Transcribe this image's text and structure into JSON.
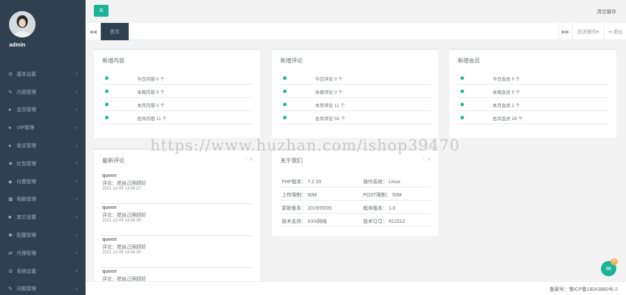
{
  "sidebar": {
    "username": "admin",
    "items": [
      {
        "icon": "gear-icon",
        "glyph": "⚙",
        "label": "基本设置"
      },
      {
        "icon": "edit-icon",
        "glyph": "✎",
        "label": "内容管理"
      },
      {
        "icon": "user-icon",
        "glyph": "●",
        "label": "会员管理"
      },
      {
        "icon": "user-icon",
        "glyph": "●",
        "label": "VIP管理"
      },
      {
        "icon": "user-icon",
        "glyph": "●",
        "label": "收支管理"
      },
      {
        "icon": "gift-icon",
        "glyph": "❖",
        "label": "红包管理"
      },
      {
        "icon": "cart-icon",
        "glyph": "◆",
        "label": "付费管理"
      },
      {
        "icon": "grid-icon",
        "glyph": "▦",
        "label": "相册管理"
      },
      {
        "icon": "square-icon",
        "glyph": "■",
        "label": "其它设置"
      },
      {
        "icon": "snowflake-icon",
        "glyph": "✱",
        "label": "配置管理"
      },
      {
        "icon": "exchange-icon",
        "glyph": "⇄",
        "label": "代理管理"
      },
      {
        "icon": "cogs-icon",
        "glyph": "⚙",
        "label": "系统设置"
      },
      {
        "icon": "edit-icon",
        "glyph": "✎",
        "label": "问题管理"
      }
    ]
  },
  "topbar": {
    "clear_cache": "清空缓存"
  },
  "tabbar": {
    "home_tab": "首页",
    "close_ops": "关闭操作▾",
    "exit": "退出"
  },
  "cards": {
    "new_content": {
      "title": "新增内容",
      "rows": [
        "今日内容 0 个",
        "本周内容 0 个",
        "本月内容 0 个",
        "总共内容 11 个"
      ]
    },
    "new_comments": {
      "title": "新增评论",
      "rows": [
        "今日评论 0 个",
        "本周评论 0 个",
        "本月评论 11 个",
        "总共评论 55 个"
      ]
    },
    "new_members": {
      "title": "新增会员",
      "rows": [
        "今日会员 0 个",
        "本周会员 0 个",
        "本月会员 2 个",
        "总共会员 28 个"
      ]
    }
  },
  "latest_comments": {
    "title": "最新评论",
    "items": [
      {
        "user": "queen",
        "text": "评论：把自己照顾好",
        "time": "2021-12-05 13:43:27"
      },
      {
        "user": "queen",
        "text": "评论：把自己照顾好",
        "time": "2021-12-05 13:43:26"
      },
      {
        "user": "queen",
        "text": "评论：把自己照顾好",
        "time": "2021-12-05 13:43:26"
      },
      {
        "user": "queen",
        "text": "评论：把自己照顾好",
        "time": ""
      }
    ]
  },
  "about": {
    "title": "关于我们",
    "rows": [
      {
        "left": "PHP版本：  7.2.33",
        "right": "操作系统：  Linux"
      },
      {
        "left": "上传限制：  50M",
        "right": "POST限制：  50M"
      },
      {
        "left": "更新版本：  2019/05/05",
        "right": "程序版本：  1.0"
      },
      {
        "left": "技术支持：  XXX网络",
        "right": "技术ＱＱ：  612012"
      }
    ]
  },
  "watermark": "https://www.huzhan.com/ishop39470",
  "footer": {
    "icp": "备案号：豫ICP备18043880号-2"
  },
  "chat": {
    "badge": "5"
  },
  "colors": {
    "sidebar": "#2f4050",
    "accent": "#1ab394",
    "bg": "#f3f3f4"
  }
}
